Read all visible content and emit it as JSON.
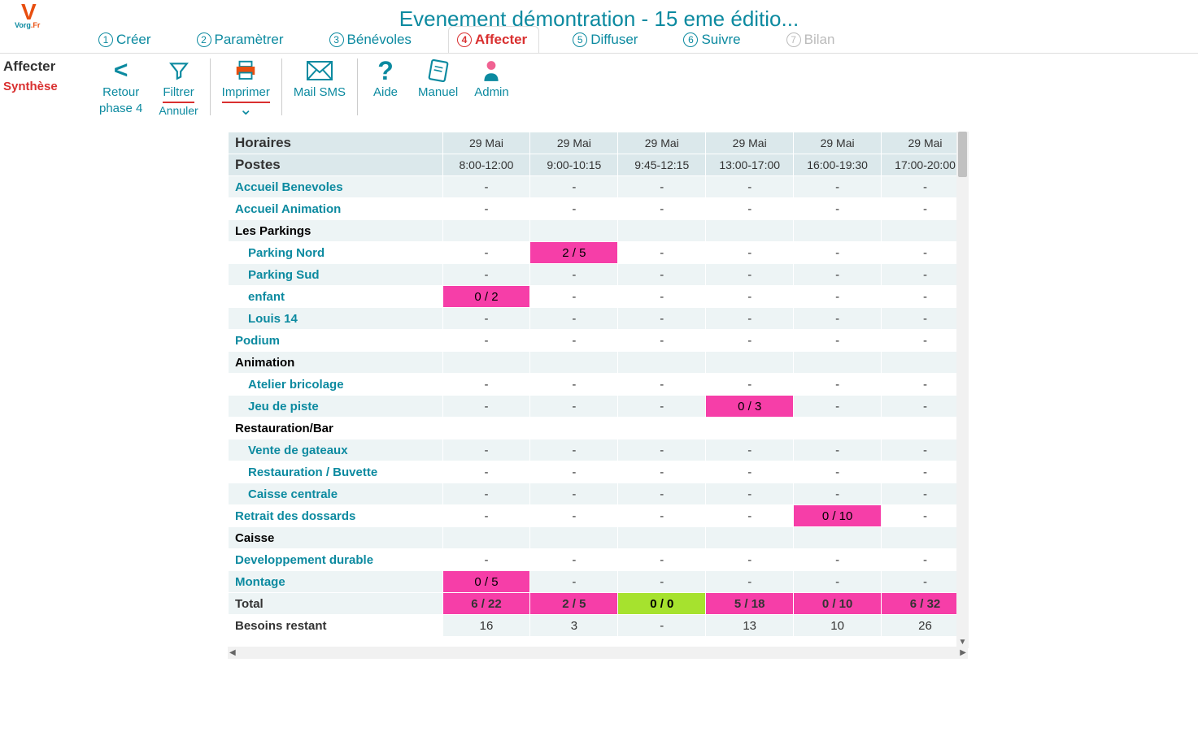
{
  "title": "Evenement démontration - 15 eme éditio...",
  "logo": {
    "brand_v": "V",
    "brand_text": "Vorg",
    "brand_fr": ".Fr"
  },
  "tabs": [
    {
      "num": "1",
      "label": "Créer",
      "active": false,
      "disabled": false
    },
    {
      "num": "2",
      "label": "Paramètrer",
      "active": false,
      "disabled": false
    },
    {
      "num": "3",
      "label": "Bénévoles",
      "active": false,
      "disabled": false
    },
    {
      "num": "4",
      "label": "Affecter",
      "active": true,
      "disabled": false
    },
    {
      "num": "5",
      "label": "Diffuser",
      "active": false,
      "disabled": false
    },
    {
      "num": "6",
      "label": "Suivre",
      "active": false,
      "disabled": false
    },
    {
      "num": "7",
      "label": "Bilan",
      "active": false,
      "disabled": true
    }
  ],
  "side": {
    "label1": "Affecter",
    "label2": "Synthèse"
  },
  "toolbar": {
    "retour": {
      "l1": "Retour",
      "l2": "phase 4",
      "icon": "<"
    },
    "filtrer": {
      "l1": "Filtrer",
      "l2": "Annuler",
      "icon": "funnel"
    },
    "imprimer": {
      "l1": "Imprimer",
      "icon": "printer",
      "chevron": "⌄"
    },
    "mail": {
      "l1": "Mail SMS",
      "icon": "✉"
    },
    "aide": {
      "l1": "Aide",
      "icon": "?"
    },
    "manuel": {
      "l1": "Manuel",
      "icon": "book"
    },
    "admin": {
      "l1": "Admin",
      "icon": "user"
    }
  },
  "table": {
    "header_rows": {
      "horaires": "Horaires",
      "postes": "Postes",
      "dates": [
        "29 Mai",
        "29 Mai",
        "29 Mai",
        "29 Mai",
        "29 Mai",
        "29 Mai"
      ],
      "times": [
        "8:00-12:00",
        "9:00-10:15",
        "9:45-12:15",
        "13:00-17:00",
        "16:00-19:30",
        "17:00-20:00"
      ]
    },
    "rows": [
      {
        "type": "link",
        "label": "Accueil Benevoles",
        "cells": [
          "-",
          "-",
          "-",
          "-",
          "-",
          "-"
        ]
      },
      {
        "type": "link",
        "label": "Accueil Animation",
        "cells": [
          "-",
          "-",
          "-",
          "-",
          "-",
          "-"
        ]
      },
      {
        "type": "group",
        "label": "Les Parkings",
        "cells": [
          "",
          "",
          "",
          "",
          "",
          ""
        ]
      },
      {
        "type": "sub",
        "label": "Parking Nord",
        "cells": [
          "-",
          {
            "v": "2 / 5",
            "c": "pink"
          },
          "-",
          "-",
          "-",
          "-"
        ]
      },
      {
        "type": "sub",
        "label": "Parking Sud",
        "cells": [
          "-",
          "-",
          "-",
          "-",
          "-",
          "-"
        ]
      },
      {
        "type": "sub",
        "label": "enfant",
        "cells": [
          {
            "v": "0 / 2",
            "c": "pink"
          },
          "-",
          "-",
          "-",
          "-",
          "-"
        ]
      },
      {
        "type": "sub",
        "label": "Louis 14",
        "cells": [
          "-",
          "-",
          "-",
          "-",
          "-",
          "-"
        ]
      },
      {
        "type": "link",
        "label": "Podium",
        "cells": [
          "-",
          "-",
          "-",
          "-",
          "-",
          "-"
        ]
      },
      {
        "type": "group",
        "label": "Animation",
        "cells": [
          "",
          "",
          "",
          "",
          "",
          ""
        ]
      },
      {
        "type": "sub",
        "label": "Atelier bricolage",
        "cells": [
          "-",
          "-",
          "-",
          "-",
          "-",
          "-"
        ]
      },
      {
        "type": "sub",
        "label": "Jeu de piste",
        "cells": [
          "-",
          "-",
          "-",
          {
            "v": "0 / 3",
            "c": "pink"
          },
          "-",
          "-"
        ]
      },
      {
        "type": "group",
        "label": "Restauration/Bar",
        "cells": [
          "",
          "",
          "",
          "",
          "",
          ""
        ]
      },
      {
        "type": "sub",
        "label": "Vente de gateaux",
        "cells": [
          "-",
          "-",
          "-",
          "-",
          "-",
          "-"
        ]
      },
      {
        "type": "sub",
        "label": "Restauration / Buvette",
        "cells": [
          "-",
          "-",
          "-",
          "-",
          "-",
          "-"
        ]
      },
      {
        "type": "sub",
        "label": "Caisse centrale",
        "cells": [
          "-",
          "-",
          "-",
          "-",
          "-",
          "-"
        ]
      },
      {
        "type": "link",
        "label": "Retrait des dossards",
        "cells": [
          "-",
          "-",
          "-",
          "-",
          {
            "v": "0 / 10",
            "c": "pink"
          },
          "-"
        ]
      },
      {
        "type": "group",
        "label": "Caisse",
        "cells": [
          "",
          "",
          "",
          "",
          "",
          ""
        ]
      },
      {
        "type": "link",
        "label": "Developpement durable",
        "cells": [
          "-",
          "-",
          "-",
          "-",
          "-",
          "-"
        ]
      },
      {
        "type": "link",
        "label": "Montage",
        "cells": [
          {
            "v": "0 / 5",
            "c": "pink"
          },
          "-",
          "-",
          "-",
          "-",
          "-"
        ]
      }
    ],
    "total": {
      "label": "Total",
      "cells": [
        {
          "v": "6 / 22"
        },
        {
          "v": "2 / 5"
        },
        {
          "v": "0 / 0",
          "c": "lime"
        },
        {
          "v": "5 / 18"
        },
        {
          "v": "0 / 10"
        },
        {
          "v": "6 / 32"
        }
      ]
    },
    "needs": {
      "label": "Besoins restant",
      "cells": [
        "16",
        "3",
        "-",
        "13",
        "10",
        "26"
      ]
    }
  }
}
